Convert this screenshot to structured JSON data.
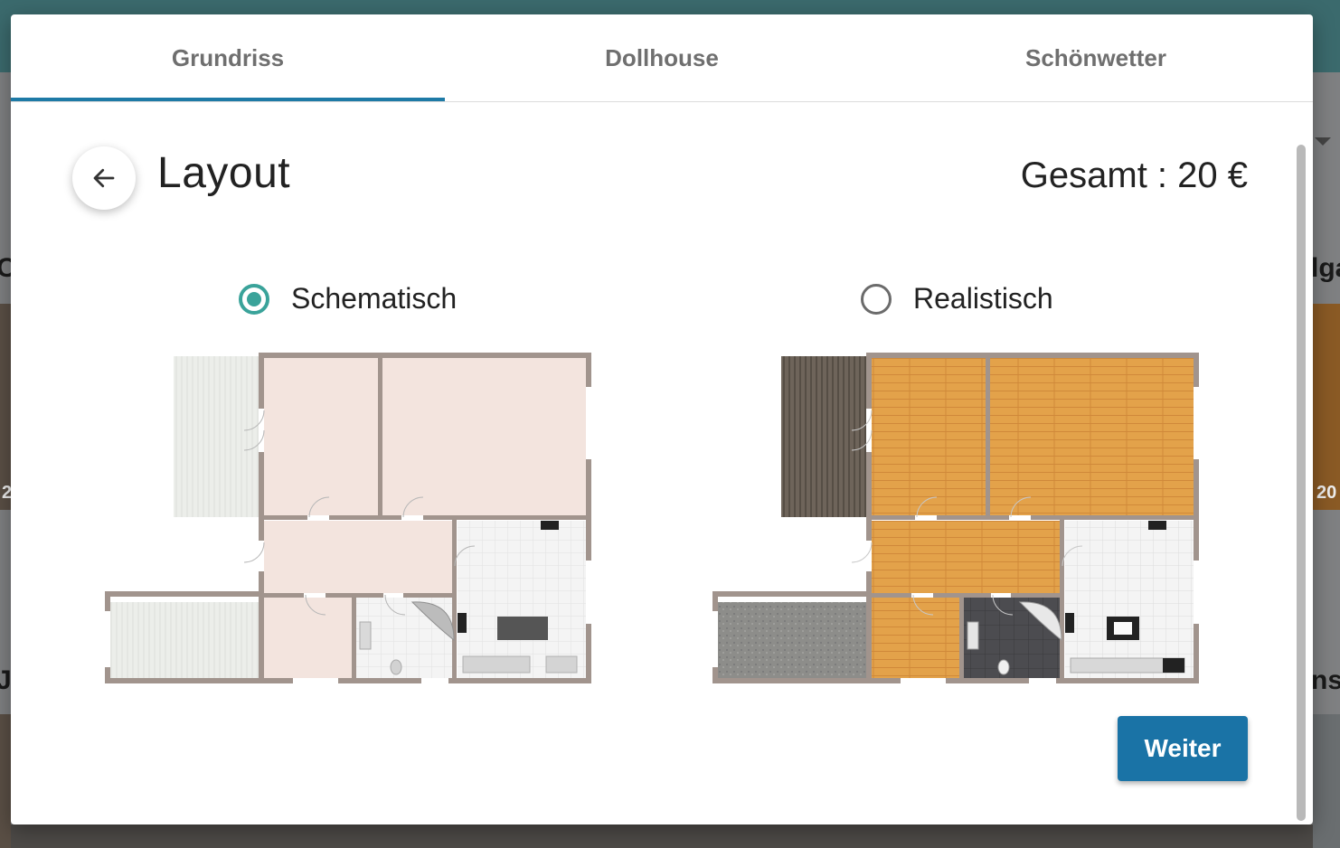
{
  "tabs": [
    {
      "label": "Grundriss",
      "active": true
    },
    {
      "label": "Dollhouse",
      "active": false
    },
    {
      "label": "Schönwetter",
      "active": false
    }
  ],
  "header": {
    "title": "Layout",
    "total": "Gesamt : 20 €"
  },
  "options": [
    {
      "label": "Schematisch",
      "selected": true
    },
    {
      "label": "Realistisch",
      "selected": false
    }
  ],
  "actions": {
    "next_label": "Weiter"
  },
  "icons": {
    "back": "arrow-left-icon"
  },
  "colors": {
    "accent": "#1a73a6",
    "radio_selected": "#3aa39a",
    "schematic_room": "#f3e4de",
    "realistic_wood": "#e3a24a",
    "wall": "#a1948d"
  },
  "background_page": {
    "partial_texts": [
      "Ol",
      "lga",
      "J",
      "ns",
      "2",
      "20"
    ]
  }
}
